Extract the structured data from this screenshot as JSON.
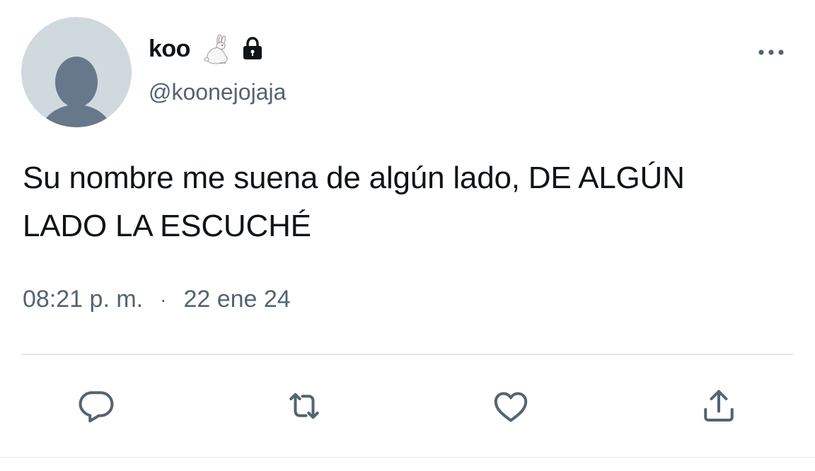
{
  "user": {
    "display_name": "koo",
    "handle": "@koonejojaja",
    "name_icons": [
      "rabbit-icon",
      "lock-icon"
    ]
  },
  "tweet": {
    "text_line1": "Su nombre me suena de algún lado, DE ALGÚN",
    "text_line2": "LADO LA ESCUCHÉ",
    "time": "08:21 p. m.",
    "separator": "·",
    "date": "22 ene 24"
  },
  "actions": [
    "reply-icon",
    "retweet-icon",
    "like-icon",
    "share-icon"
  ],
  "colors": {
    "text": "#0f1419",
    "secondary": "#536471",
    "avatar_bg": "#cfd9de",
    "avatar_fg": "#66788a",
    "divider": "#e7eaec"
  }
}
